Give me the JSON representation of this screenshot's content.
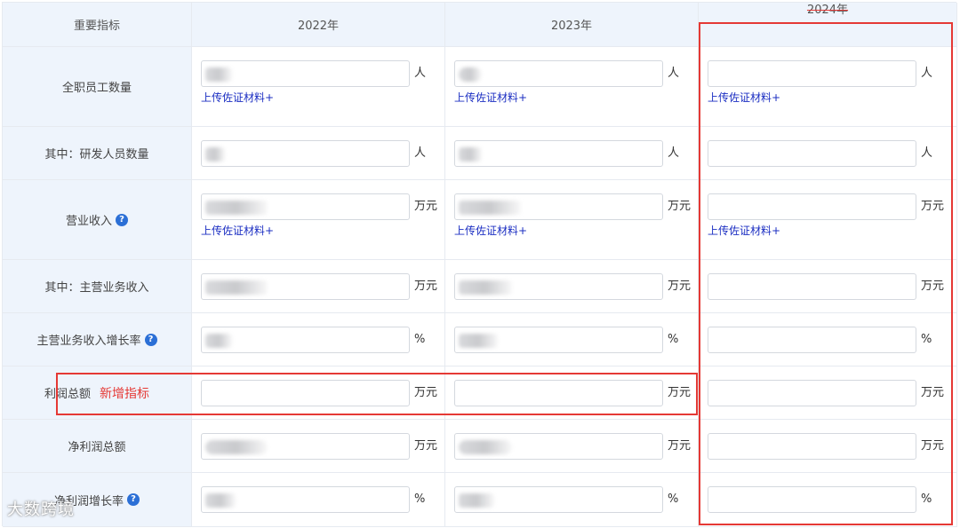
{
  "header": {
    "indicator": "重要指标",
    "y2022": "2022年",
    "y2023": "2023年",
    "y2024": "2024年"
  },
  "rows": [
    {
      "label": "全职员工数量",
      "unit": "人",
      "upload": "上传佐证材料+"
    },
    {
      "label": "其中：研发人员数量",
      "unit": "人"
    },
    {
      "label": "营业收入",
      "unit": "万元",
      "upload": "上传佐证材料+"
    },
    {
      "label": "其中：主营业务收入",
      "unit": "万元"
    },
    {
      "label": "主营业务收入增长率",
      "unit": "%"
    },
    {
      "label": "利润总额",
      "unit": "万元",
      "tag": "新增指标"
    },
    {
      "label": "净利润总额",
      "unit": "万元"
    },
    {
      "label": "净利润增长率",
      "unit": "%"
    }
  ],
  "watermark": "大数跨境",
  "colors": {
    "accent": "#e53935",
    "link": "#1b2ec2",
    "header_bg": "#eef4fc",
    "help": "#2b6fd6"
  }
}
